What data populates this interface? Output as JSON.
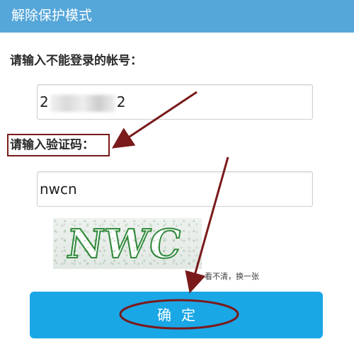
{
  "header": {
    "title": "解除保护模式",
    "bg_color": "#55a6d9"
  },
  "form": {
    "account_label": "请输入不能登录的帐号：",
    "account_value_prefix": "2",
    "account_value_suffix": "2",
    "captcha_label": "请输入验证码：",
    "captcha_value": "nwcn",
    "captcha_image_text": "NWC",
    "refresh_link": "看不清，换一张",
    "confirm_label": "确定",
    "confirm_color": "#1aa7e6"
  },
  "annotation": {
    "color": "#7a1a1a"
  }
}
